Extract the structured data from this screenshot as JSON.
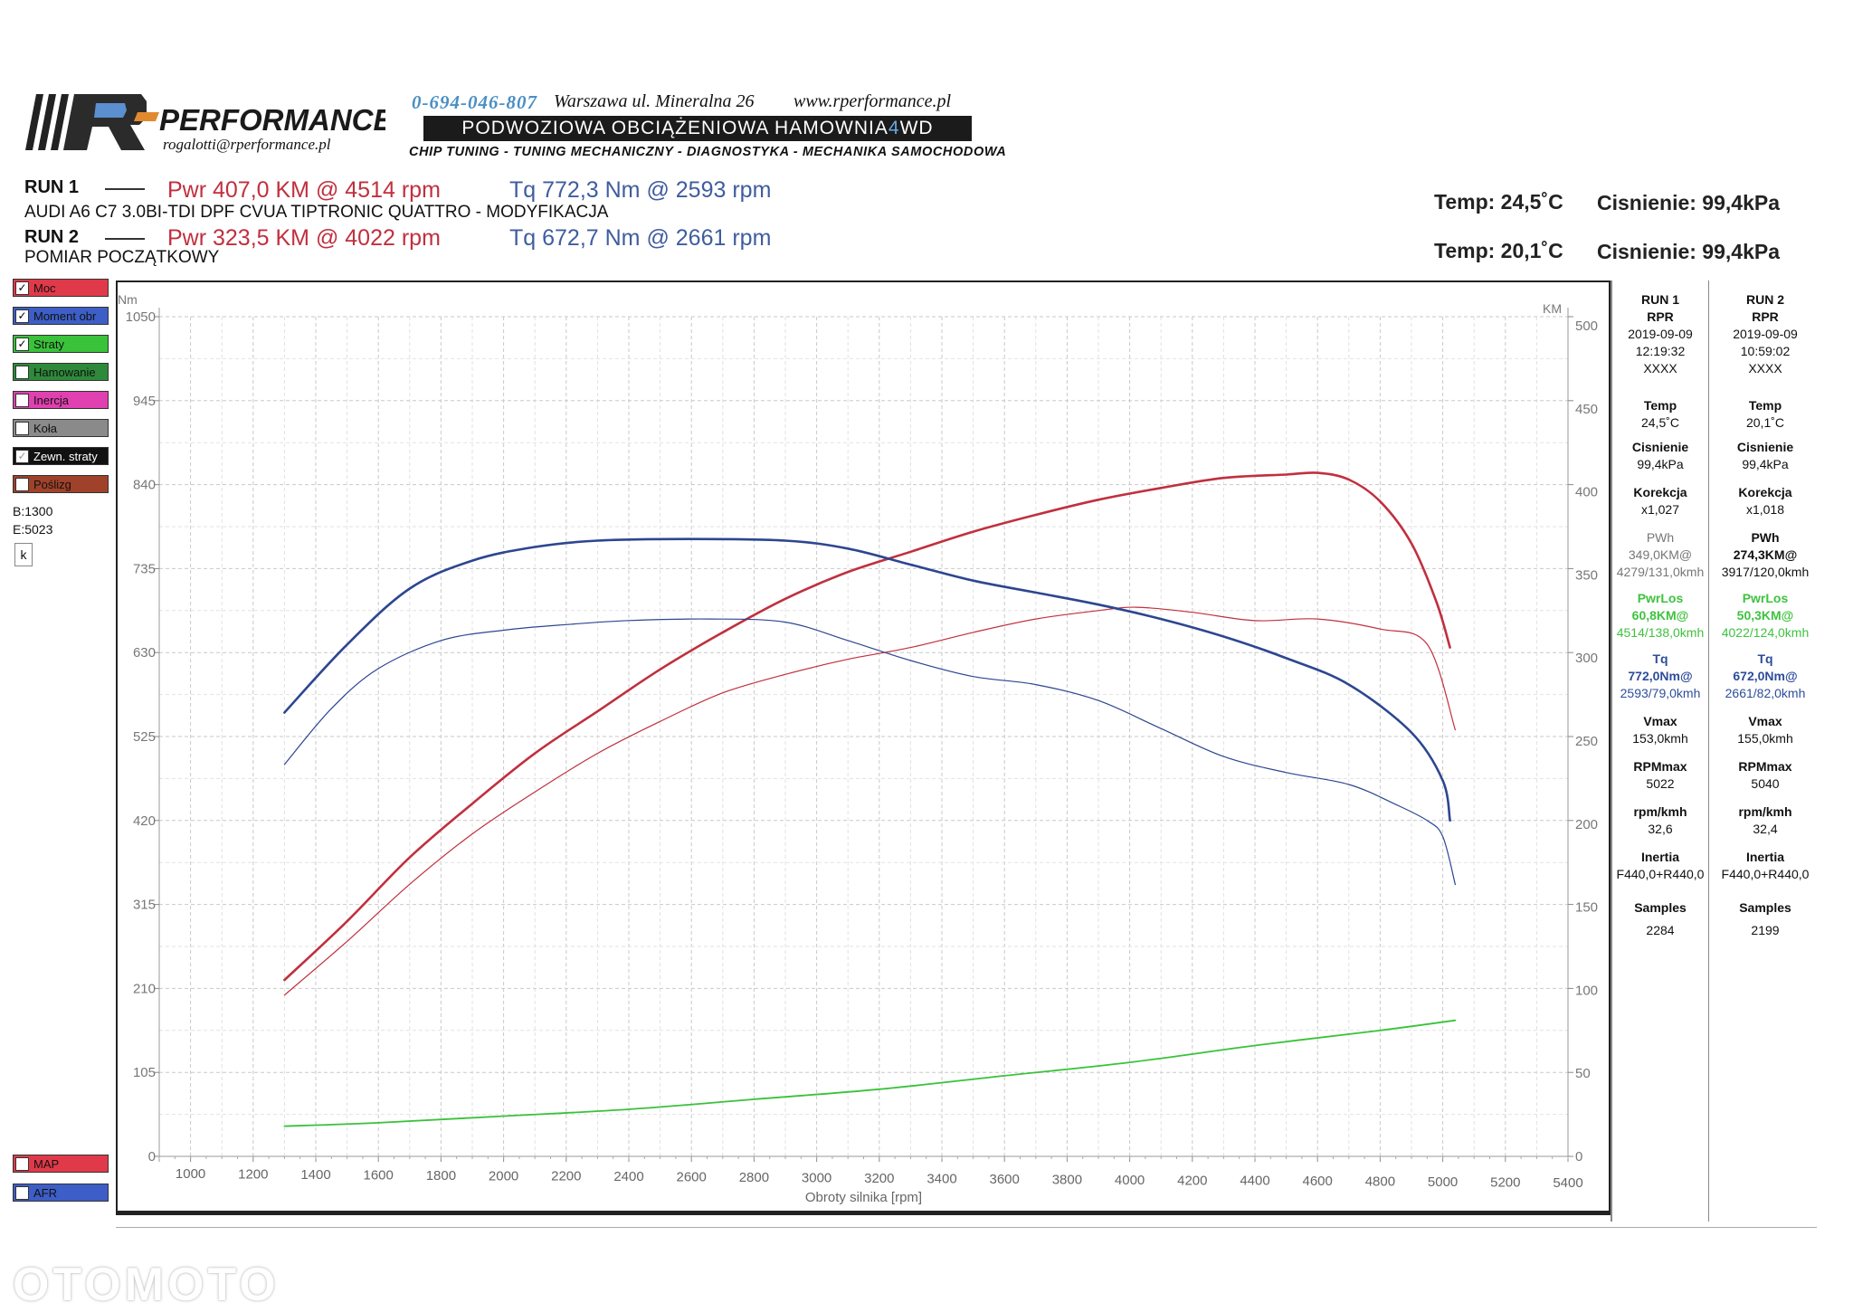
{
  "header": {
    "logo_letter": "R",
    "brand": "PERFORMANCE",
    "email": "rogalotti@rperformance.pl",
    "phone": "0-694-046-807",
    "address": "Warszawa ul. Mineralna 26",
    "website": "www.rperformance.pl",
    "banner_main": "PODWOZIOWA OBCIĄŻENIOWA HAMOWNIA ",
    "banner_4": "4",
    "banner_wd": "WD",
    "services": "CHIP TUNING - TUNING MECHANICZNY - DIAGNOSTYKA - MECHANIKA SAMOCHODOWA"
  },
  "runs": [
    {
      "label": "RUN 1",
      "pwr": "Pwr  407,0 KM @ 4514 rpm",
      "tq": "Tq 772,3 Nm @ 2593 rpm",
      "desc": "AUDI A6 C7 3.0BI-TDI DPF CVUA TIPTRONIC QUATTRO - MODYFIKACJA",
      "temp": "Temp: 24,5˚C",
      "pressure": "Cisnienie: 99,4kPa"
    },
    {
      "label": "RUN 2",
      "pwr": "Pwr  323,5 KM @ 4022 rpm",
      "tq": "Tq 672,7 Nm @ 2661 rpm",
      "desc": "POMIAR POCZĄTKOWY",
      "temp": "Temp: 20,1˚C",
      "pressure": "Cisnienie: 99,4kPa"
    }
  ],
  "legend_toggles": [
    {
      "label": "Moc",
      "checked": true,
      "color": "#e03a4a"
    },
    {
      "label": "Moment obr",
      "checked": true,
      "color": "#3d5ec6"
    },
    {
      "label": "Straty",
      "checked": true,
      "color": "#39c23a"
    },
    {
      "label": "Hamowanie",
      "checked": false,
      "color": "#2e8a3a"
    },
    {
      "label": "Inercja",
      "checked": false,
      "color": "#e040b0"
    },
    {
      "label": "Koła",
      "checked": false,
      "color": "#8a8a8a"
    },
    {
      "label": "Zewn. straty",
      "checked": true,
      "color": "#111111"
    },
    {
      "label": "Poślizg",
      "checked": false,
      "color": "#a0422a"
    }
  ],
  "side_notes": {
    "b": "B:1300",
    "e": "E:5023",
    "k": "k"
  },
  "bottom_toggles": [
    {
      "label": "MAP",
      "checked": false,
      "color": "#e03a4a"
    },
    {
      "label": "AFR",
      "checked": false,
      "color": "#3d5ec6"
    }
  ],
  "chart_data": {
    "type": "line",
    "xlabel": "Obroty silnika [rpm]",
    "ylabel_left": "Nm",
    "ylabel_right": "KM",
    "xlim": [
      900,
      5400
    ],
    "ylim_left": [
      0,
      1050
    ],
    "ylim_right": [
      0,
      500
    ],
    "x_ticks": [
      1000,
      1200,
      1400,
      1600,
      1800,
      2000,
      2200,
      2400,
      2600,
      2800,
      3000,
      3200,
      3400,
      3600,
      3800,
      4000,
      4200,
      4400,
      4600,
      4800,
      5000,
      5200,
      5400
    ],
    "y_ticks_left": [
      0,
      105,
      210,
      315,
      420,
      525,
      630,
      735,
      840,
      945,
      1050
    ],
    "y_ticks_right": [
      0,
      50,
      100,
      150,
      200,
      250,
      300,
      350,
      400,
      450,
      500
    ],
    "grid": true,
    "series": [
      {
        "name": "Moc",
        "axis": "right",
        "color": "#c0303e",
        "width": 2.6,
        "x": [
          1300,
          1500,
          1700,
          1900,
          2100,
          2300,
          2500,
          2700,
          2900,
          3100,
          3300,
          3500,
          3700,
          3900,
          4100,
          4300,
          4500,
          4600,
          4700,
          4800,
          4900,
          4980,
          5023
        ],
        "y": [
          105,
          140,
          178,
          210,
          240,
          265,
          290,
          312,
          332,
          348,
          360,
          372,
          382,
          391,
          398,
          404,
          406,
          407,
          403,
          390,
          365,
          330,
          303
        ]
      },
      {
        "name": "Moc",
        "axis": "right",
        "color": "#c0303e",
        "width": 1.2,
        "x": [
          1300,
          1500,
          1700,
          1900,
          2100,
          2300,
          2500,
          2700,
          2900,
          3100,
          3300,
          3500,
          3700,
          3900,
          4022,
          4200,
          4400,
          4600,
          4800,
          4950,
          5040
        ],
        "y": [
          96,
          128,
          162,
          192,
          217,
          240,
          259,
          276,
          287,
          296,
          303,
          312,
          320,
          325,
          327,
          324,
          319,
          320,
          314,
          305,
          254
        ]
      },
      {
        "name": "Moment obr",
        "axis": "left",
        "color": "#2d4690",
        "width": 2.6,
        "x": [
          1300,
          1500,
          1700,
          1900,
          2100,
          2300,
          2593,
          2900,
          3100,
          3300,
          3500,
          3700,
          3900,
          4100,
          4300,
          4500,
          4700,
          4900,
          5000,
          5023
        ],
        "y": [
          555,
          640,
          710,
          745,
          762,
          770,
          772,
          770,
          760,
          740,
          720,
          705,
          690,
          672,
          650,
          623,
          590,
          530,
          470,
          420
        ]
      },
      {
        "name": "Moment obr",
        "axis": "left",
        "color": "#2d4690",
        "width": 1.2,
        "x": [
          1300,
          1450,
          1600,
          1800,
          2000,
          2200,
          2400,
          2661,
          2900,
          3100,
          3300,
          3500,
          3700,
          3900,
          4100,
          4300,
          4500,
          4700,
          4850,
          4950,
          5000,
          5040
        ],
        "y": [
          490,
          560,
          610,
          645,
          658,
          665,
          670,
          672,
          668,
          645,
          620,
          600,
          590,
          570,
          535,
          500,
          480,
          465,
          440,
          420,
          400,
          340
        ]
      },
      {
        "name": "Straty",
        "axis": "right",
        "color": "#39c23a",
        "width": 1.8,
        "x": [
          1300,
          1600,
          2000,
          2400,
          2800,
          3200,
          3600,
          4000,
          4400,
          4800,
          5040
        ],
        "y": [
          18,
          20,
          24,
          28,
          34,
          40,
          48,
          56,
          66,
          75,
          81
        ]
      }
    ]
  },
  "table": {
    "cols": [
      {
        "run": "RUN 1",
        "tag": "RPR",
        "date": "2019-09-09",
        "time": "12:19:32",
        "id": "XXXX",
        "temp_h": "Temp",
        "temp": "24,5˚C",
        "cis_h": "Cisnienie",
        "cis": "99,4kPa",
        "kor_h": "Korekcja",
        "kor": "x1,027",
        "pwh_h": "PWh",
        "pwh1": "349,0KM@",
        "pwh2": "4279/131,0kmh",
        "los_h": "PwrLos",
        "los1": "60,8KM@",
        "los2": "4514/138,0kmh",
        "tq_h": "Tq",
        "tq1": "772,0Nm@",
        "tq2": "2593/79,0kmh",
        "vmax_h": "Vmax",
        "vmax": "153,0kmh",
        "rpm_h": "RPMmax",
        "rpm": "5022",
        "rk_h": "rpm/kmh",
        "rk": "32,6",
        "in_h": "Inertia",
        "in": "F440,0+R440,0",
        "s_h": "Samples",
        "s": "2284"
      },
      {
        "run": "RUN 2",
        "tag": "RPR",
        "date": "2019-09-09",
        "time": "10:59:02",
        "id": "XXXX",
        "temp_h": "Temp",
        "temp": "20,1˚C",
        "cis_h": "Cisnienie",
        "cis": "99,4kPa",
        "kor_h": "Korekcja",
        "kor": "x1,018",
        "pwh_h": "PWh",
        "pwh1": "274,3KM@",
        "pwh2": "3917/120,0kmh",
        "los_h": "PwrLos",
        "los1": "50,3KM@",
        "los2": "4022/124,0kmh",
        "tq_h": "Tq",
        "tq1": "672,0Nm@",
        "tq2": "2661/82,0kmh",
        "vmax_h": "Vmax",
        "vmax": "155,0kmh",
        "rpm_h": "RPMmax",
        "rpm": "5040",
        "rk_h": "rpm/kmh",
        "rk": "32,4",
        "in_h": "Inertia",
        "in": "F440,0+R440,0",
        "s_h": "Samples",
        "s": "2199"
      }
    ]
  },
  "watermark": "OTOMOTO"
}
